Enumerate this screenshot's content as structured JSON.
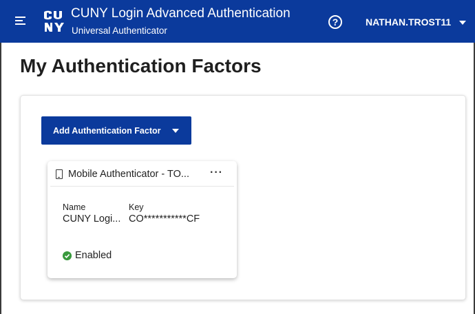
{
  "header": {
    "app_title": "CUNY Login Advanced Authentication",
    "app_subtitle": "Universal Authenticator",
    "help_glyph": "?",
    "user_name": "NATHAN.TROST11",
    "icons": {
      "menu": "hamburger-icon",
      "logo": "cuny-logo",
      "help": "help-circle-icon",
      "user_menu": "caret-down-icon"
    }
  },
  "page": {
    "title": "My Authentication Factors"
  },
  "toolbar": {
    "add_label": "Add Authentication Factor"
  },
  "factor_card": {
    "title": "Mobile Authenticator - TO...",
    "menu_glyph": "···",
    "name_label": "Name",
    "name_value": "CUNY Logi...",
    "key_label": "Key",
    "key_value": "CO***********CF",
    "status": "Enabled",
    "icons": {
      "device": "mobile-phone-icon",
      "status": "check-circle-icon"
    },
    "status_color": "#3a9a3e"
  },
  "colors": {
    "brand": "#0b3a9c",
    "background": "#ffffff"
  }
}
